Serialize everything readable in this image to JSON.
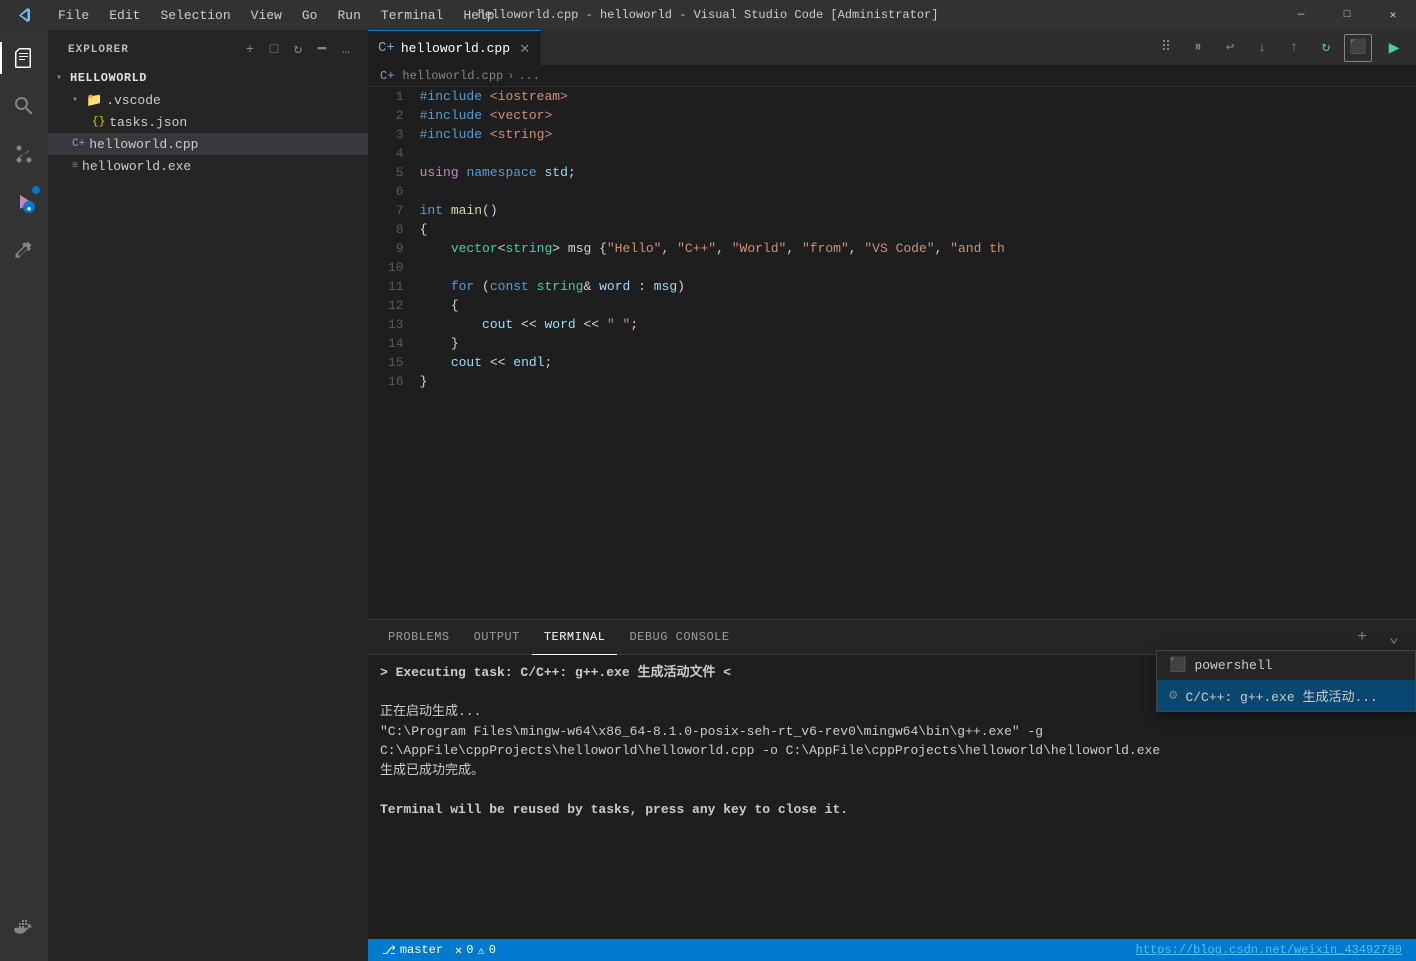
{
  "titlebar": {
    "title": "helloworld.cpp - helloworld - Visual Studio Code [Administrator]",
    "menus": [
      "File",
      "Edit",
      "Selection",
      "View",
      "Go",
      "Run",
      "Terminal",
      "Help"
    ],
    "controls": [
      "minimize",
      "maximize",
      "close"
    ]
  },
  "activity_bar": {
    "icons": [
      {
        "name": "explorer",
        "label": "Explorer",
        "active": true
      },
      {
        "name": "search",
        "label": "Search",
        "active": false
      },
      {
        "name": "source-control",
        "label": "Source Control",
        "active": false
      },
      {
        "name": "run-debug",
        "label": "Run and Debug",
        "active": false,
        "badge": true
      },
      {
        "name": "extensions",
        "label": "Extensions",
        "active": false
      }
    ],
    "bottom_icons": [
      {
        "name": "docker",
        "label": "Docker",
        "active": false
      }
    ]
  },
  "sidebar": {
    "title": "Explorer",
    "root_folder": "HELLOWORLD",
    "items": [
      {
        "label": ".vscode",
        "type": "folder",
        "expanded": true,
        "indent": 1
      },
      {
        "label": "tasks.json",
        "type": "json",
        "indent": 2
      },
      {
        "label": "helloworld.cpp",
        "type": "cpp",
        "indent": 1,
        "selected": true
      },
      {
        "label": "helloworld.exe",
        "type": "exe",
        "indent": 1
      }
    ]
  },
  "editor": {
    "tab": {
      "filename": "helloworld.cpp",
      "icon": "C++"
    },
    "breadcrumb": {
      "parts": [
        "helloworld.cpp",
        "..."
      ]
    },
    "code_lines": [
      {
        "num": 1,
        "tokens": [
          {
            "t": "kw",
            "v": "#include"
          },
          {
            "t": "plain",
            "v": " "
          },
          {
            "t": "include-path",
            "v": "<iostream>"
          }
        ]
      },
      {
        "num": 2,
        "tokens": [
          {
            "t": "kw",
            "v": "#include"
          },
          {
            "t": "plain",
            "v": " "
          },
          {
            "t": "include-path",
            "v": "<vector>"
          }
        ]
      },
      {
        "num": 3,
        "tokens": [
          {
            "t": "kw",
            "v": "#include"
          },
          {
            "t": "plain",
            "v": " "
          },
          {
            "t": "include-path",
            "v": "<string>"
          }
        ]
      },
      {
        "num": 4,
        "tokens": []
      },
      {
        "num": 5,
        "tokens": [
          {
            "t": "kw2",
            "v": "using"
          },
          {
            "t": "plain",
            "v": " "
          },
          {
            "t": "kw",
            "v": "namespace"
          },
          {
            "t": "plain",
            "v": " "
          },
          {
            "t": "ns",
            "v": "std"
          },
          {
            "t": "plain",
            "v": ";"
          }
        ]
      },
      {
        "num": 6,
        "tokens": []
      },
      {
        "num": 7,
        "tokens": [
          {
            "t": "kw",
            "v": "int"
          },
          {
            "t": "plain",
            "v": " "
          },
          {
            "t": "func",
            "v": "main"
          },
          {
            "t": "plain",
            "v": "()"
          }
        ]
      },
      {
        "num": 8,
        "tokens": [
          {
            "t": "plain",
            "v": "{"
          }
        ]
      },
      {
        "num": 9,
        "tokens": [
          {
            "t": "plain",
            "v": "    "
          },
          {
            "t": "type",
            "v": "vector"
          },
          {
            "t": "plain",
            "v": "<"
          },
          {
            "t": "type",
            "v": "string"
          },
          {
            "t": "plain",
            "v": "> msg {"
          },
          {
            "t": "str",
            "v": "\"Hello\""
          },
          {
            "t": "plain",
            "v": ", "
          },
          {
            "t": "str",
            "v": "\"C++\""
          },
          {
            "t": "plain",
            "v": ", "
          },
          {
            "t": "str",
            "v": "\"World\""
          },
          {
            "t": "plain",
            "v": ", "
          },
          {
            "t": "str",
            "v": "\"from\""
          },
          {
            "t": "plain",
            "v": ", "
          },
          {
            "t": "str",
            "v": "\"VS Code\""
          },
          {
            "t": "plain",
            "v": ", "
          },
          {
            "t": "str",
            "v": "\"and th"
          }
        ]
      },
      {
        "num": 10,
        "tokens": []
      },
      {
        "num": 11,
        "tokens": [
          {
            "t": "plain",
            "v": "    "
          },
          {
            "t": "kw",
            "v": "for"
          },
          {
            "t": "plain",
            "v": " ("
          },
          {
            "t": "kw",
            "v": "const"
          },
          {
            "t": "plain",
            "v": " "
          },
          {
            "t": "type",
            "v": "string"
          },
          {
            "t": "plain",
            "v": "& "
          },
          {
            "t": "ns",
            "v": "word"
          },
          {
            "t": "plain",
            "v": " : "
          },
          {
            "t": "ns",
            "v": "msg"
          },
          {
            "t": "plain",
            "v": ")"
          }
        ]
      },
      {
        "num": 12,
        "tokens": [
          {
            "t": "plain",
            "v": "    {"
          }
        ]
      },
      {
        "num": 13,
        "tokens": [
          {
            "t": "plain",
            "v": "        "
          },
          {
            "t": "ns",
            "v": "cout"
          },
          {
            "t": "plain",
            "v": " << "
          },
          {
            "t": "ns",
            "v": "word"
          },
          {
            "t": "plain",
            "v": " << "
          },
          {
            "t": "str",
            "v": "\" \""
          },
          {
            "t": "plain",
            "v": ";"
          }
        ]
      },
      {
        "num": 14,
        "tokens": [
          {
            "t": "plain",
            "v": "    }"
          }
        ]
      },
      {
        "num": 15,
        "tokens": [
          {
            "t": "plain",
            "v": "    "
          },
          {
            "t": "ns",
            "v": "cout"
          },
          {
            "t": "plain",
            "v": " << "
          },
          {
            "t": "ns",
            "v": "endl"
          },
          {
            "t": "plain",
            "v": ";"
          }
        ]
      },
      {
        "num": 16,
        "tokens": [
          {
            "t": "plain",
            "v": "}"
          }
        ]
      }
    ]
  },
  "terminal": {
    "tabs": [
      "PROBLEMS",
      "OUTPUT",
      "TERMINAL",
      "DEBUG CONSOLE"
    ],
    "active_tab": "TERMINAL",
    "content": {
      "command_line": "> Executing task: C/C++: g++.exe 生成活动文件 <",
      "output_lines": [
        "正在启动生成...",
        "\"C:\\Program Files\\mingw-w64\\x86_64-8.1.0-posix-seh-rt_v6-rev0\\mingw64\\bin\\g++.exe\" -g C:\\AppFile\\cppProjects\\helloworld\\helloworld.cpp -o C:\\AppFile\\cppProjects\\helloworld\\helloworld.exe",
        "生成已成功完成。",
        "",
        "Terminal will be reused by tasks, press any key to close it."
      ]
    },
    "dropdown": {
      "items": [
        {
          "label": "powershell",
          "icon": "terminal"
        },
        {
          "label": "C/C++: g++.exe 生成活动...",
          "icon": "settings-gear",
          "active": true
        }
      ]
    },
    "status_link": "https://blog.csdn.net/weixin_43492780"
  }
}
